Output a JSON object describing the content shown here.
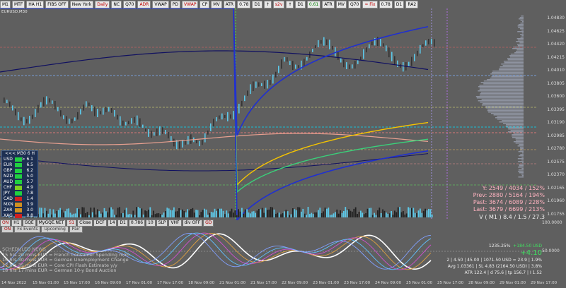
{
  "toolbar": {
    "buttons": [
      "M1",
      "MTF",
      "HA H1",
      "FIBS OFF",
      "New York",
      "Daily",
      "NC",
      "Q70",
      "ADR",
      "VWAP",
      "PD",
      "VWAP",
      "CP",
      "MV",
      "ATR",
      "0.78",
      "D1",
      "↑",
      "s2v",
      "↑",
      "D1",
      "0.61",
      "ATR",
      "MV",
      "Q70",
      "≈ Fix",
      "0.78",
      "D1",
      "RA2"
    ],
    "red_indices": [
      5,
      8,
      11,
      18,
      25
    ],
    "green_indices": [
      21
    ]
  },
  "symbol": "EURUSD,M30",
  "price_axis": [
    "1.04830",
    "1.04625",
    "1.04420",
    "1.04215",
    "1.04010",
    "1.03805",
    "1.03600",
    "1.03395",
    "1.03190",
    "1.02985",
    "1.02780",
    "1.02575",
    "1.02370",
    "1.02165",
    "1.01960",
    "1.01755"
  ],
  "chart_labels": {
    "v_line": "V ( M1 ) 8.4 / 1.5 / 27.3",
    "lines": [
      {
        "label": "Y:",
        "val": "2549 / 4034 / 152%"
      },
      {
        "label": "Prev:",
        "val": "2880 / 5164 / 194%"
      },
      {
        "label": "Past:",
        "val": "3674 / 6089 / 228%"
      },
      {
        "label": "Last:",
        "val": "3679 / 6699 / 213%"
      }
    ]
  },
  "lower_toolbar": {
    "row1": [
      "ON",
      "H1",
      "GQE",
      "MyGQE.NET",
      "S1",
      "Close",
      "DCF",
      "14",
      "D1",
      "0.786",
      "10",
      "SLP",
      "VHF",
      "div OFF",
      "GD"
    ],
    "row1_red": [
      0,
      4,
      14
    ],
    "row2": [
      "ON",
      "Fx Events",
      "Upcoming",
      "Pair"
    ]
  },
  "strength_meter": {
    "title": "<<<  M30  6  H  >>>",
    "rows": [
      {
        "name": "USD",
        "value": "6.1",
        "color": "#20d040"
      },
      {
        "name": "EUR",
        "value": "6.5",
        "color": "#20d040"
      },
      {
        "name": "GBP",
        "value": "6.2",
        "color": "#20d040"
      },
      {
        "name": "NZD",
        "value": "5.0",
        "color": "#20d040"
      },
      {
        "name": "AUD",
        "value": "5.7",
        "color": "#20d040"
      },
      {
        "name": "CHF",
        "value": "4.9",
        "color": "#80d020"
      },
      {
        "name": "JPY",
        "value": "7.8",
        "color": "#20d040"
      },
      {
        "name": "CAD",
        "value": "1.4",
        "color": "#d02020"
      },
      {
        "name": "MXN",
        "value": "3.9",
        "color": "#d09020"
      },
      {
        "name": "ZAR",
        "value": "3.0",
        "color": "#d09020"
      },
      {
        "name": "XAG",
        "value": "0.8",
        "color": "#d02020"
      }
    ]
  },
  "schedule": {
    "title": "SCHEDULED NEWS",
    "items": [
      "15 hrs 20 mins  EUR  =  French Consumer Spending m/m",
      "16 hrs 30 mins  EUR  =  German Unemployment Change",
      "17 hrs 35 mins  EUR  =  Core CPI Flash Estimate y/y",
      "18 hrs 17 mins  EUR  =  German 10-y Bond Auction"
    ]
  },
  "stats": {
    "line1": "1235.25%",
    "line1b": "+184.50 USD",
    "line2": "+4.10",
    "line3": "2  |  4.50  |  45.00  |  1071.50 USD = 23.9  |  1.9%",
    "line4": "Avg 1.03361  |  SL 4.83 (2164.50 USD)  |  3.8%",
    "line5": "ATR 122.4  |  d 75.6  |  tp 156.7  |  I 1.52"
  },
  "x_axis": [
    "14 Nov 2022",
    "15 Nov 01:00",
    "15 Nov 17:00",
    "16 Nov 09:00",
    "17 Nov 01:00",
    "17 Nov 17:00",
    "18 Nov 09:00",
    "21 Nov 01:00",
    "21 Nov 17:00",
    "22 Nov 09:00",
    "23 Nov 01:00",
    "23 Nov 17:00",
    "24 Nov 09:00",
    "25 Nov 01:00",
    "25 Nov 17:00",
    "28 Nov 09:00",
    "29 Nov 01:00",
    "29 Nov 17:00"
  ],
  "osc_axis": [
    "100.0000",
    "50.0000"
  ],
  "colors": {
    "bg": "#5f5f5f",
    "candle_up": "#5cc8e8",
    "candle_dn": "#333333",
    "yellow": "#f5c400",
    "green": "#3ad07a",
    "blue": "#2030d0"
  }
}
